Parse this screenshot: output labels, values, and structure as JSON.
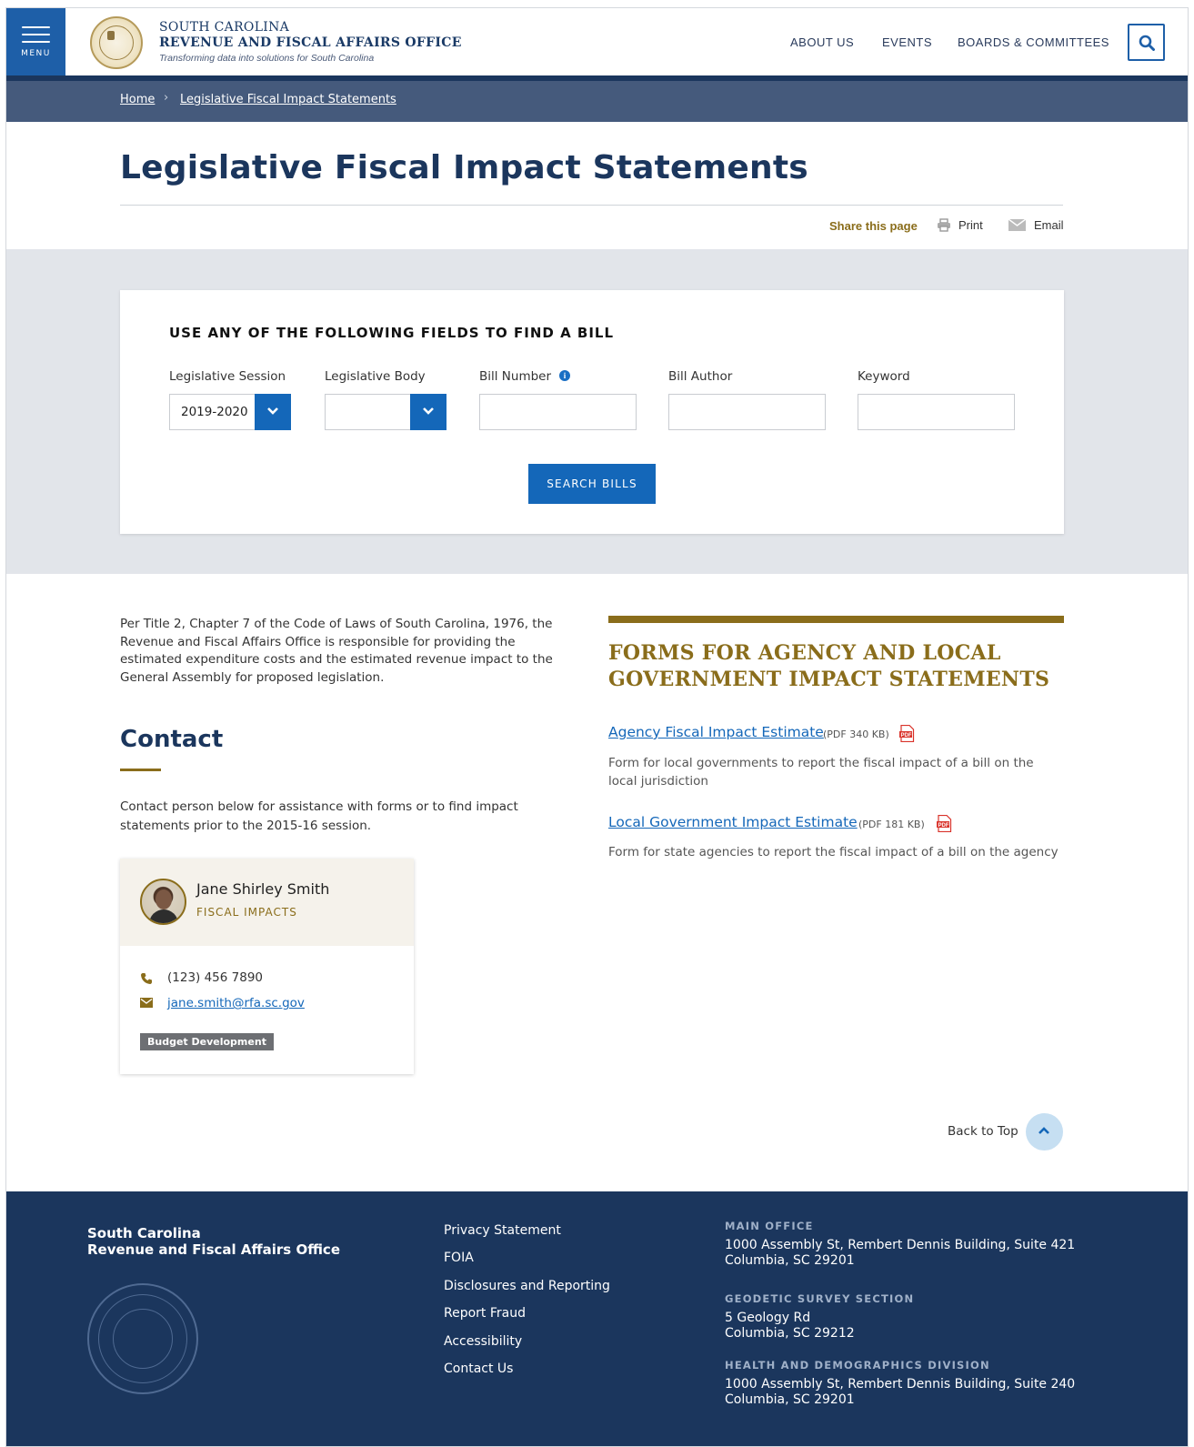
{
  "header": {
    "menu_label": "MENU",
    "org_line1": "SOUTH CAROLINA",
    "org_line2": "REVENUE AND FISCAL AFFAIRS OFFICE",
    "tagline": "Transforming data into solutions for South Carolina",
    "nav": [
      "ABOUT US",
      "EVENTS",
      "BOARDS & COMMITTEES"
    ],
    "brand_color": "#1b365d",
    "accent_color": "#1467b9",
    "gold_color": "#8a6d1b"
  },
  "breadcrumb": {
    "home": "Home",
    "current": "Legislative Fiscal Impact Statements"
  },
  "page": {
    "title": "Legislative Fiscal Impact Statements",
    "share_label": "Share this page",
    "print_label": "Print",
    "email_label": "Email"
  },
  "search": {
    "heading": "USE ANY OF THE FOLLOWING FIELDS TO FIND A BILL",
    "session_label": "Legislative Session",
    "session_value": "2019-2020",
    "body_label": "Legislative Body",
    "body_value": "",
    "bill_number_label": "Bill Number",
    "bill_author_label": "Bill Author",
    "keyword_label": "Keyword",
    "button_label": "SEARCH BILLS"
  },
  "content": {
    "intro": "Per Title 2, Chapter 7 of the Code of Laws of South Carolina, 1976, the Revenue and Fiscal Affairs Office is responsible for providing the estimated expenditure costs and the estimated revenue impact to the General Assembly for proposed legislation.",
    "contact_heading": "Contact",
    "contact_desc": "Contact person below for assistance with forms or to find impact statements prior to the 2015-16 session."
  },
  "contact_card": {
    "name": "Jane Shirley Smith",
    "role": "FISCAL IMPACTS",
    "phone": "(123) 456 7890",
    "email": "jane.smith@rfa.sc.gov",
    "tag": "Budget Development"
  },
  "forms": {
    "heading": "FORMS FOR AGENCY AND LOCAL GOVERNMENT IMPACT STATEMENTS",
    "items": [
      {
        "title": "Agency Fiscal Impact Estimate",
        "size": "(PDF 340 KB)",
        "desc": "Form for local governments to report the fiscal impact of a bill on the local jurisdiction"
      },
      {
        "title": "Local Government Impact Estimate",
        "size": "(PDF 181 KB)",
        "desc": "Form for state agencies to report the fiscal impact of a bill on the agency"
      }
    ]
  },
  "back_to_top": "Back to Top",
  "footer": {
    "org_line1": "South Carolina",
    "org_line2": "Revenue and Fiscal Affairs Office",
    "links": [
      "Privacy Statement",
      "FOIA",
      "Disclosures and Reporting",
      "Report Fraud",
      "Accessibility",
      "Contact Us"
    ],
    "offices": [
      {
        "heading": "MAIN OFFICE",
        "line1": "1000 Assembly St, Rembert Dennis Building, Suite 421",
        "line2": "Columbia, SC 29201"
      },
      {
        "heading": "GEODETIC SURVEY SECTION",
        "line1": "5 Geology Rd",
        "line2": "Columbia, SC 29212"
      },
      {
        "heading": "HEALTH AND DEMOGRAPHICS DIVISION",
        "line1": "1000 Assembly St, Rembert Dennis Building, Suite 240",
        "line2": "Columbia, SC 29201"
      }
    ]
  }
}
